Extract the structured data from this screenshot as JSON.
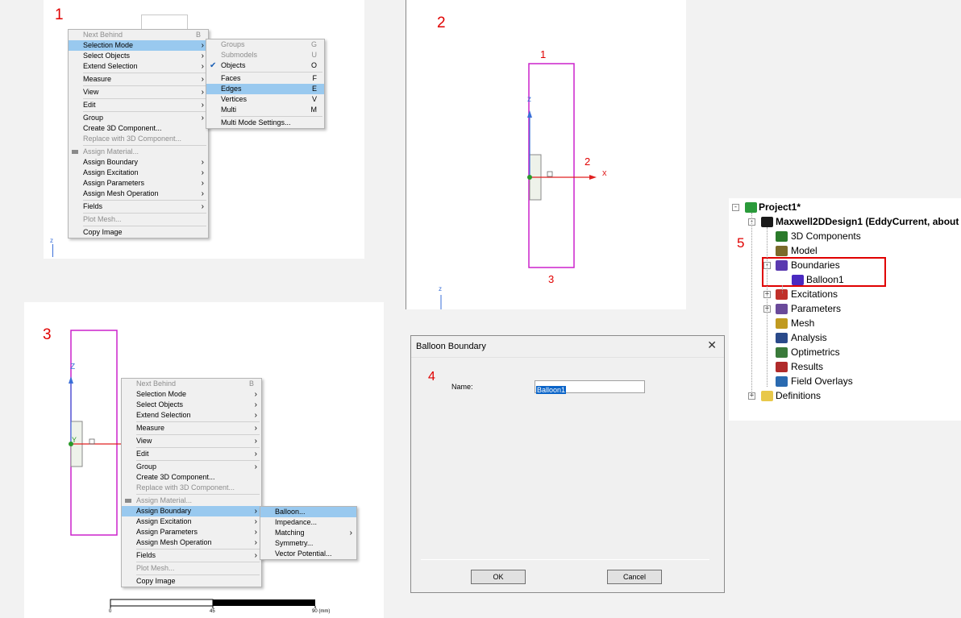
{
  "steps": [
    "1",
    "2",
    "3",
    "4",
    "5"
  ],
  "menu1": {
    "items": [
      {
        "label": "Next Behind",
        "key": "B",
        "disabled": true
      },
      {
        "label": "Selection Mode",
        "arrow": true,
        "highlight": true
      },
      {
        "label": "Select Objects",
        "arrow": true
      },
      {
        "label": "Extend Selection",
        "arrow": true
      },
      {
        "sep": true
      },
      {
        "label": "Measure",
        "arrow": true
      },
      {
        "sep": true
      },
      {
        "label": "View",
        "arrow": true
      },
      {
        "sep": true
      },
      {
        "label": "Edit",
        "arrow": true
      },
      {
        "sep": true
      },
      {
        "label": "Group",
        "arrow": true
      },
      {
        "label": "Create 3D Component..."
      },
      {
        "label": "Replace with 3D Component...",
        "disabled": true
      },
      {
        "sep": true
      },
      {
        "label": "Assign Material...",
        "disabled": true,
        "icon": true
      },
      {
        "label": "Assign Boundary",
        "arrow": true
      },
      {
        "label": "Assign Excitation",
        "arrow": true
      },
      {
        "label": "Assign Parameters",
        "arrow": true
      },
      {
        "label": "Assign Mesh Operation",
        "arrow": true
      },
      {
        "sep": true
      },
      {
        "label": "Fields",
        "arrow": true
      },
      {
        "sep": true
      },
      {
        "label": "Plot Mesh...",
        "disabled": true
      },
      {
        "sep": true
      },
      {
        "label": "Copy Image"
      }
    ]
  },
  "submenu1": {
    "items": [
      {
        "label": "Groups",
        "key": "G",
        "disabled": true
      },
      {
        "label": "Submodels",
        "key": "U",
        "disabled": true
      },
      {
        "label": "Objects",
        "key": "O",
        "checked": true
      },
      {
        "sep": true
      },
      {
        "label": "Faces",
        "key": "F"
      },
      {
        "label": "Edges",
        "key": "E",
        "highlight": true
      },
      {
        "label": "Vertices",
        "key": "V"
      },
      {
        "label": "Multi",
        "key": "M"
      },
      {
        "sep": true
      },
      {
        "label": "Multi Mode Settings..."
      }
    ]
  },
  "menu3": {
    "items": [
      {
        "label": "Next Behind",
        "key": "B",
        "disabled": true
      },
      {
        "label": "Selection Mode",
        "arrow": true
      },
      {
        "label": "Select Objects",
        "arrow": true
      },
      {
        "label": "Extend Selection",
        "arrow": true
      },
      {
        "sep": true
      },
      {
        "label": "Measure",
        "arrow": true
      },
      {
        "sep": true
      },
      {
        "label": "View",
        "arrow": true
      },
      {
        "sep": true
      },
      {
        "label": "Edit",
        "arrow": true
      },
      {
        "sep": true
      },
      {
        "label": "Group",
        "arrow": true
      },
      {
        "label": "Create 3D Component..."
      },
      {
        "label": "Replace with 3D Component...",
        "disabled": true
      },
      {
        "sep": true
      },
      {
        "label": "Assign Material...",
        "disabled": true,
        "icon": true
      },
      {
        "label": "Assign Boundary",
        "arrow": true,
        "highlight": true
      },
      {
        "label": "Assign Excitation",
        "arrow": true
      },
      {
        "label": "Assign Parameters",
        "arrow": true
      },
      {
        "label": "Assign Mesh Operation",
        "arrow": true
      },
      {
        "sep": true
      },
      {
        "label": "Fields",
        "arrow": true
      },
      {
        "sep": true
      },
      {
        "label": "Plot Mesh...",
        "disabled": true
      },
      {
        "sep": true
      },
      {
        "label": "Copy Image"
      }
    ]
  },
  "submenu3": {
    "items": [
      {
        "label": "Balloon...",
        "highlight": true
      },
      {
        "label": "Impedance..."
      },
      {
        "label": "Matching",
        "arrow": true
      },
      {
        "label": "Symmetry..."
      },
      {
        "label": "Vector Potential..."
      }
    ]
  },
  "viewport2": {
    "edge_labels": [
      "1",
      "2",
      "3"
    ],
    "axis_z": "z",
    "axis_x": "x"
  },
  "viewport3": {
    "axis_z": "Z",
    "axis_y": "Y",
    "scale_labels": [
      "0",
      "45",
      "90 (mm)"
    ]
  },
  "dialog": {
    "title": "Balloon Boundary",
    "name_label": "Name:",
    "name_value": "Balloon1",
    "ok": "OK",
    "cancel": "Cancel"
  },
  "tree": {
    "project": "Project1*",
    "design": "Maxwell2DDesign1 (EddyCurrent, about",
    "items": [
      "3D Components",
      "Model",
      "Boundaries",
      "Balloon1",
      "Excitations",
      "Parameters",
      "Mesh",
      "Analysis",
      "Optimetrics",
      "Results",
      "Field Overlays"
    ],
    "definitions": "Definitions"
  },
  "colors": {
    "highlight": "#99c9ef",
    "step_red": "#e00000",
    "magenta": "#cc22cc",
    "axis_red": "#e02020",
    "axis_blue": "#3a6fd8"
  }
}
